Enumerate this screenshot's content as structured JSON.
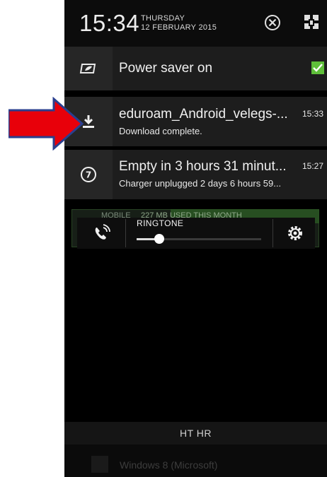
{
  "header": {
    "time": "15:34",
    "day": "THURSDAY",
    "date": "12 FEBRUARY 2015",
    "clear_icon": "clear-all-icon",
    "settings_icon": "quick-settings-icon"
  },
  "notifications": [
    {
      "icon": "battery-leaf-icon",
      "title": "Power saver on",
      "checked": true
    },
    {
      "icon": "download-icon",
      "title": "eduroam_Android_velegs-...",
      "subtitle": "Download complete.",
      "time": "15:33"
    },
    {
      "icon": "battery-7-icon",
      "title": "Empty in 3 hours 31 minut...",
      "subtitle": "Charger unplugged 2 days 6 hours 59...",
      "time": "15:27"
    }
  ],
  "background": {
    "mobile_label": "MOBILE",
    "usage_label": "227 MB USED THIS MONTH",
    "usage_label_2": "USED THIS MONTH"
  },
  "ringtone": {
    "label": "RINGTONE",
    "volume_level": 0.18
  },
  "carrier": "HT HR",
  "bottom_app": "Windows 8 (Microsoft)",
  "annotation": {
    "arrow_color": "#e8000a",
    "arrow_border": "#2a3f8f"
  }
}
